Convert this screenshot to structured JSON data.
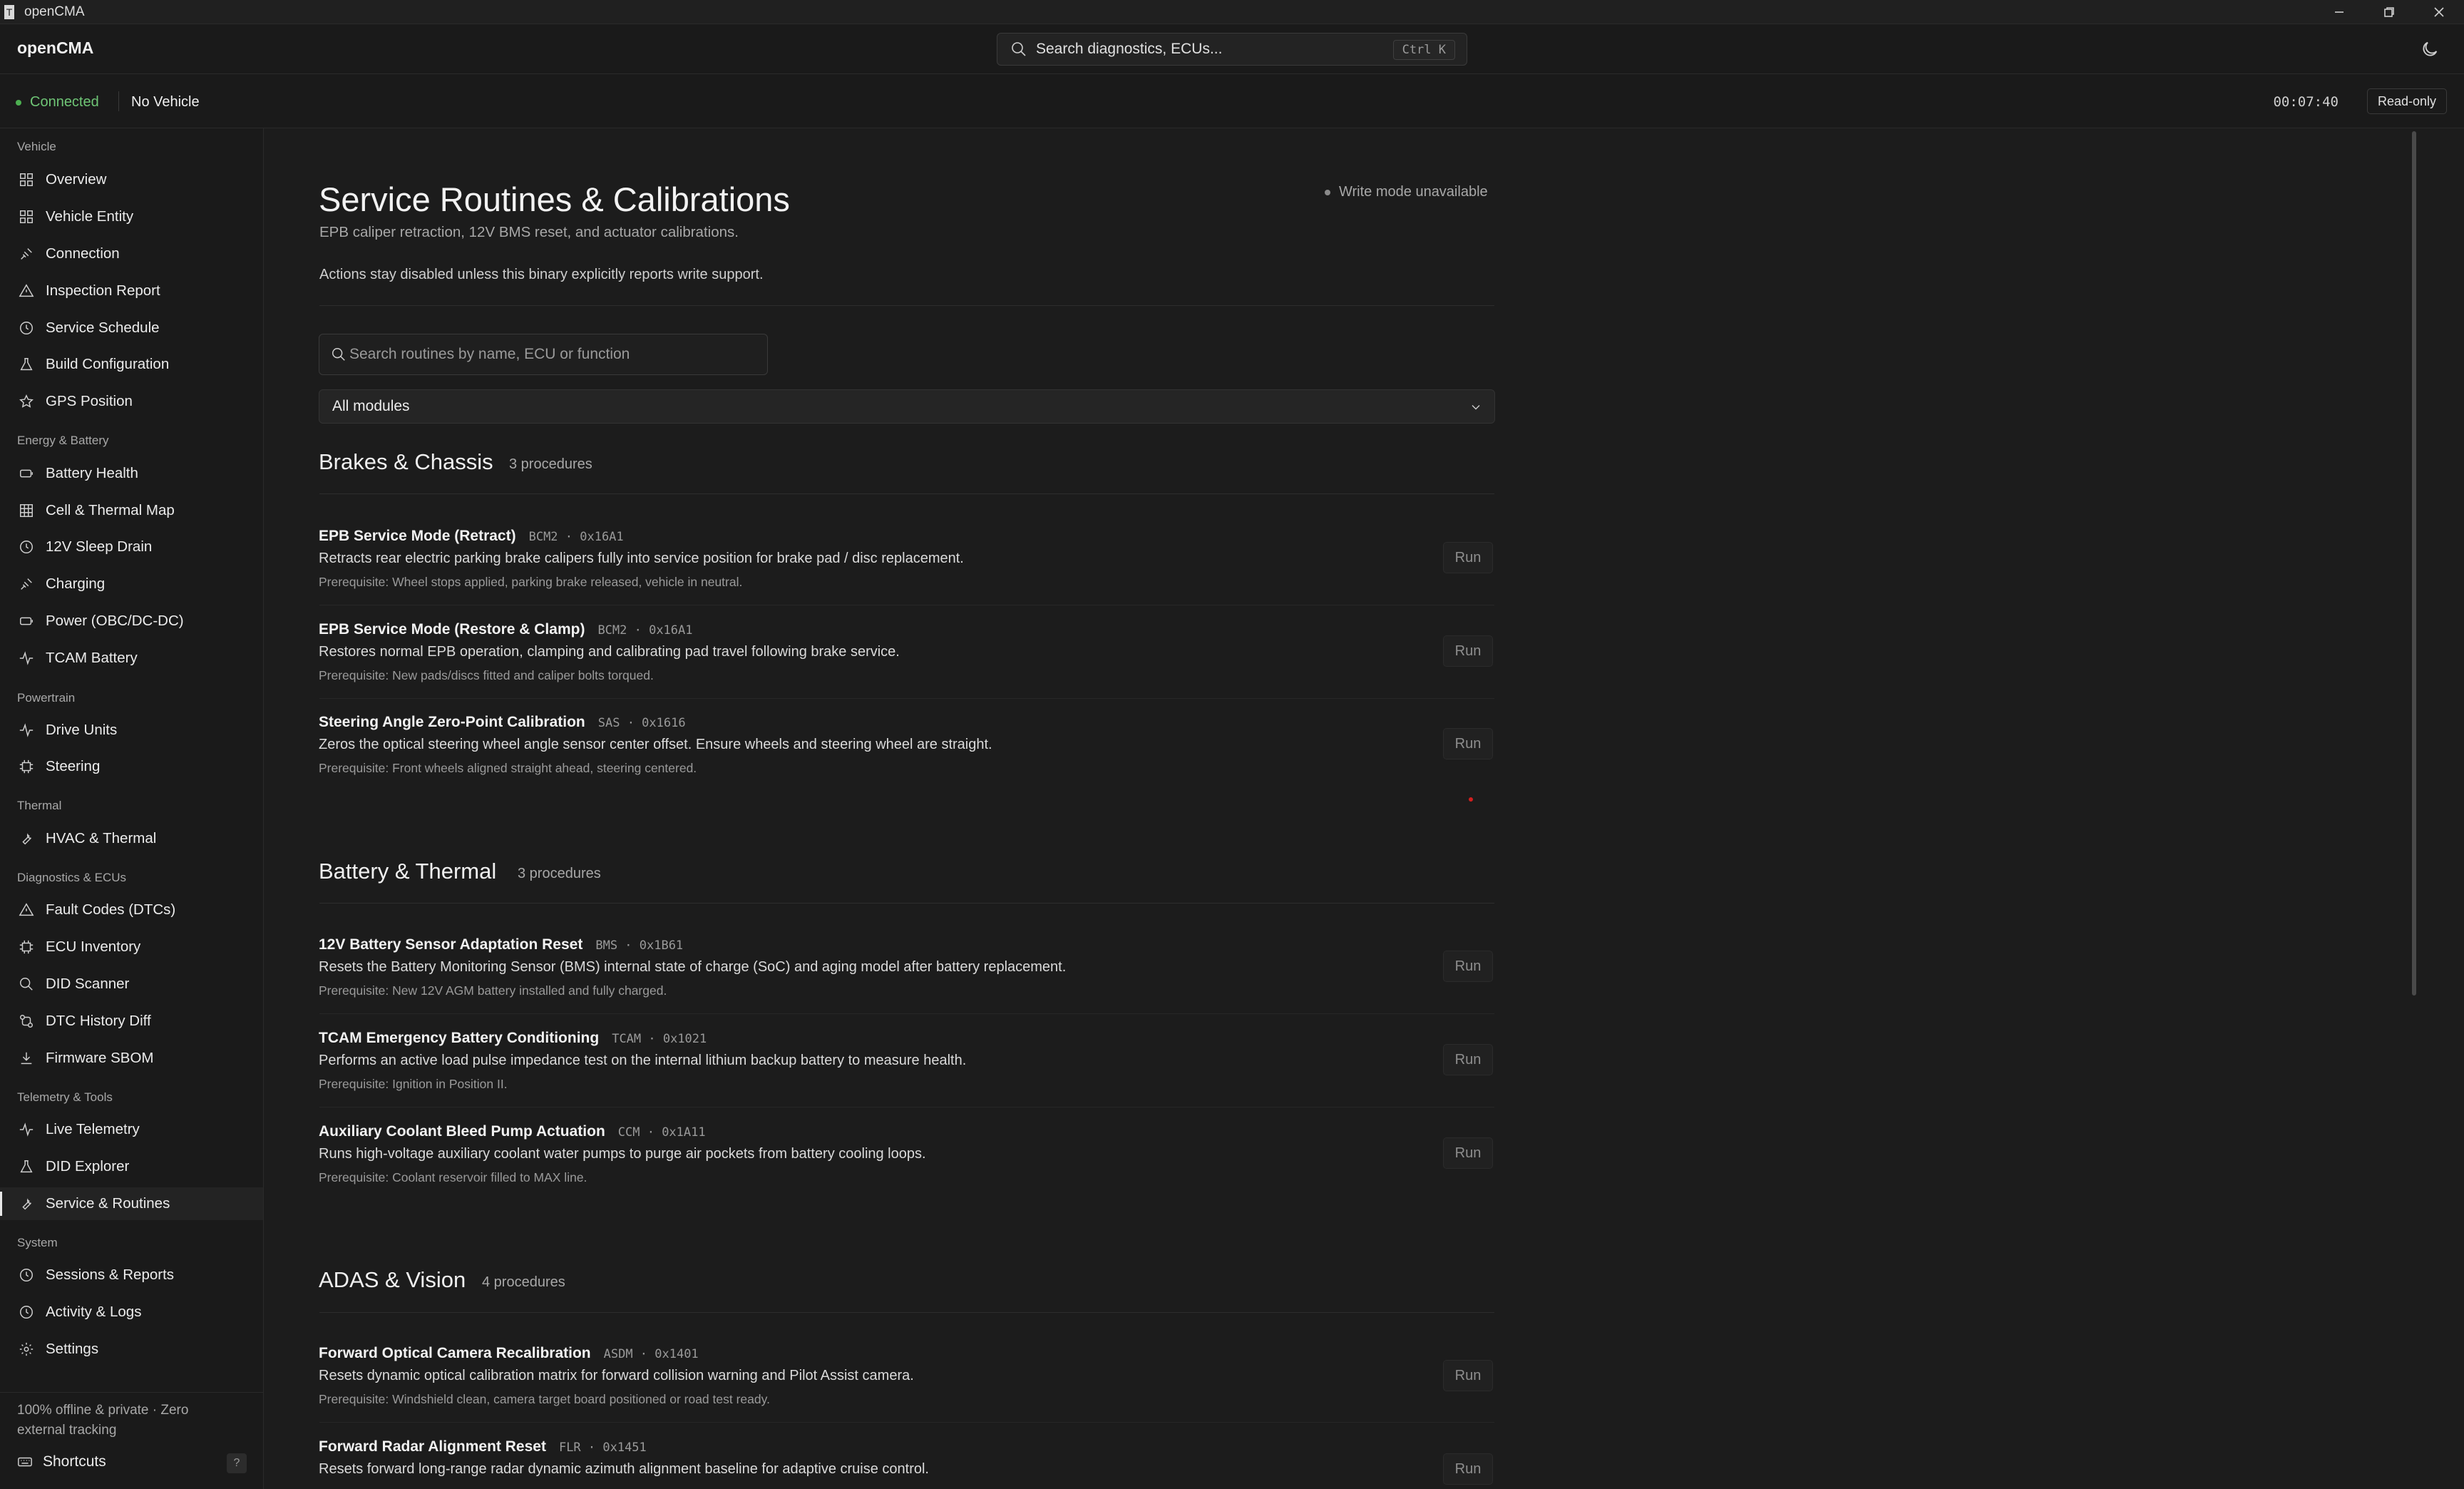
{
  "window": {
    "title": "openCMA",
    "app_icon": "T"
  },
  "header": {
    "brand": "openCMA",
    "search_placeholder": "Search diagnostics, ECUs...",
    "search_shortcut": "Ctrl K"
  },
  "status": {
    "connection": "Connected",
    "vehicle": "No Vehicle",
    "elapsed": "00:07:40",
    "mode": "Read-only"
  },
  "sidebar": {
    "sections": {
      "vehicle": "Vehicle",
      "energy": "Energy & Battery",
      "powertrain": "Powertrain",
      "thermal": "Thermal",
      "diagnostics": "Diagnostics & ECUs",
      "telemetry": "Telemetry & Tools",
      "system": "System"
    },
    "items": {
      "overview": "Overview",
      "vehicle_entity": "Vehicle Entity",
      "connection": "Connection",
      "inspection_report": "Inspection Report",
      "service_schedule": "Service Schedule",
      "build_configuration": "Build Configuration",
      "gps_position": "GPS Position",
      "battery_health": "Battery Health",
      "cell_thermal_map": "Cell & Thermal Map",
      "sleep_drain": "12V Sleep Drain",
      "charging": "Charging",
      "power": "Power (OBC/DC-DC)",
      "tcam_battery": "TCAM Battery",
      "drive_units": "Drive Units",
      "steering": "Steering",
      "hvac_thermal": "HVAC & Thermal",
      "fault_codes": "Fault Codes (DTCs)",
      "ecu_inventory": "ECU Inventory",
      "did_scanner": "DID Scanner",
      "dtc_history_diff": "DTC History Diff",
      "firmware_sbom": "Firmware SBOM",
      "live_telemetry": "Live Telemetry",
      "did_explorer": "DID Explorer",
      "service_routines": "Service & Routines",
      "sessions_reports": "Sessions & Reports",
      "activity_logs": "Activity & Logs",
      "settings": "Settings"
    },
    "footer_note": "100% offline & private · Zero external tracking",
    "shortcuts_label": "Shortcuts",
    "shortcuts_key": "?"
  },
  "page": {
    "title": "Service Routines & Calibrations",
    "subtitle": "EPB caliper retraction, 12V BMS reset, and actuator calibrations.",
    "write_status": "Write mode unavailable",
    "note": "Actions stay disabled unless this binary explicitly reports write support.",
    "search_placeholder": "Search routines by name, ECU or function",
    "module_filter": "All modules",
    "run_label": "Run"
  },
  "groups": [
    {
      "title": "Brakes & Chassis",
      "count": "3 procedures",
      "routines": [
        {
          "name": "EPB Service Mode (Retract)",
          "tag": "BCM2 · 0x16A1",
          "description": "Retracts rear electric parking brake calipers fully into service position for brake pad / disc replacement.",
          "prereq": "Prerequisite: Wheel stops applied, parking brake released, vehicle in neutral."
        },
        {
          "name": "EPB Service Mode (Restore & Clamp)",
          "tag": "BCM2 · 0x16A1",
          "description": "Restores normal EPB operation, clamping and calibrating pad travel following brake service.",
          "prereq": "Prerequisite: New pads/discs fitted and caliper bolts torqued."
        },
        {
          "name": "Steering Angle Zero-Point Calibration",
          "tag": "SAS · 0x1616",
          "description": "Zeros the optical steering wheel angle sensor center offset. Ensure wheels and steering wheel are straight.",
          "prereq": "Prerequisite: Front wheels aligned straight ahead, steering centered."
        }
      ]
    },
    {
      "title": "Battery & Thermal",
      "count": "3 procedures",
      "routines": [
        {
          "name": "12V Battery Sensor Adaptation Reset",
          "tag": "BMS · 0x1B61",
          "description": "Resets the Battery Monitoring Sensor (BMS) internal state of charge (SoC) and aging model after battery replacement.",
          "prereq": "Prerequisite: New 12V AGM battery installed and fully charged."
        },
        {
          "name": "TCAM Emergency Battery Conditioning",
          "tag": "TCAM · 0x1021",
          "description": "Performs an active load pulse impedance test on the internal lithium backup battery to measure health.",
          "prereq": "Prerequisite: Ignition in Position II."
        },
        {
          "name": "Auxiliary Coolant Bleed Pump Actuation",
          "tag": "CCM · 0x1A11",
          "description": "Runs high-voltage auxiliary coolant water pumps to purge air pockets from battery cooling loops.",
          "prereq": "Prerequisite: Coolant reservoir filled to MAX line."
        }
      ]
    },
    {
      "title": "ADAS & Vision",
      "count": "4 procedures",
      "routines": [
        {
          "name": "Forward Optical Camera Recalibration",
          "tag": "ASDM · 0x1401",
          "description": "Resets dynamic optical calibration matrix for forward collision warning and Pilot Assist camera.",
          "prereq": "Prerequisite: Windshield clean, camera target board positioned or road test ready."
        },
        {
          "name": "Forward Radar Alignment Reset",
          "tag": "FLR · 0x1451",
          "description": "Resets forward long-range radar dynamic azimuth alignment baseline for adaptive cruise control.",
          "prereq": ""
        }
      ]
    }
  ]
}
